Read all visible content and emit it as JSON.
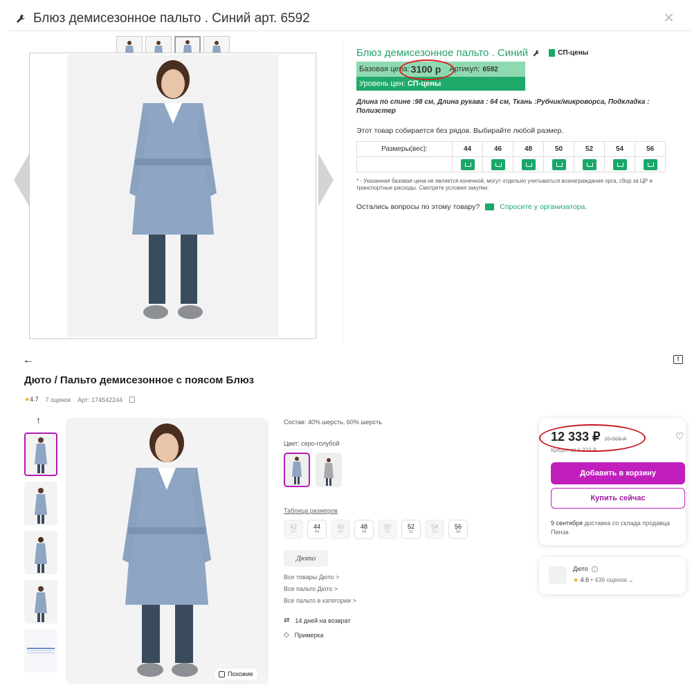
{
  "top": {
    "title": "Блюз демисезонное пальто . Синий арт. 6592",
    "close": "×",
    "info_title": "Блюз демисезонное пальто . Синий",
    "sp_badge": "СП-цены",
    "base_price_label": "Базовая цена:",
    "base_price": "3100 р",
    "article_label": "Артикул:",
    "article": "6592",
    "level_label": "Уровень цен:",
    "level": "СП-цены",
    "description": "Длина по спине :98 см, Длина рукава : 64 см, Ткань :Рубчик/микроворса, Подкладка : Полиэстер",
    "note": "Этот товар собирается без рядов. Выбирайте любой размер.",
    "sizes_label": "Размеры(вес):",
    "sizes": [
      "44",
      "46",
      "48",
      "50",
      "52",
      "54",
      "56"
    ],
    "footnote": "* - Указанная базовая цена не является конечной, могут отдельно учитываться вознаграждание орга, сбор за ЦР и транспортные расходы. Смотрите условия закупки.",
    "question": "Остались вопросы по этому товару?",
    "ask_link": "Спросите у организатора."
  },
  "bottom": {
    "back": "←",
    "report": "!",
    "title": "Дюто / Пальто демисезонное с поясом Блюз",
    "star": "★",
    "rating": "4.7",
    "reviews": "7 оценок",
    "article": "Арт: 174542244",
    "up": "↑",
    "similar": "Похожие",
    "composition": "Состав: 40% шерсть, 60% шерсть",
    "color": "Цвет: серо-голубой",
    "size_table_link": "Таблица размеров",
    "sizes": [
      {
        "size": "42",
        "sub": "42",
        "available": false
      },
      {
        "size": "44",
        "sub": "44",
        "available": true
      },
      {
        "size": "46",
        "sub": "46",
        "available": false
      },
      {
        "size": "48",
        "sub": "48",
        "available": true
      },
      {
        "size": "50",
        "sub": "50",
        "available": false
      },
      {
        "size": "52",
        "sub": "52",
        "available": true
      },
      {
        "size": "54",
        "sub": "54",
        "available": false
      },
      {
        "size": "56",
        "sub": "56",
        "available": true
      }
    ],
    "brand": "Дюто",
    "links": [
      "Все товары Дюто >",
      "Все пальто Дюто >",
      "Все пальто в категории >"
    ],
    "perks": [
      "14 дней на возврат",
      "Примерка"
    ],
    "price": "12 333 ₽",
    "old_price": "29 908 ₽",
    "credit": "Кредит от 1 233 ₽",
    "add_to_cart": "Добавить в корзину",
    "buy_now": "Купить сейчас",
    "delivery_date": "9 сентября",
    "delivery_text": "доставка со склада продавца Пенза",
    "seller_name": "Дюто",
    "seller_rating": "4.6",
    "seller_reviews": "• 436 оценок"
  },
  "colors": {
    "green": "#1aa86a",
    "light_green": "#8fd9b1",
    "purple": "#c01fbd",
    "annotation_red": "#d91e1e"
  }
}
